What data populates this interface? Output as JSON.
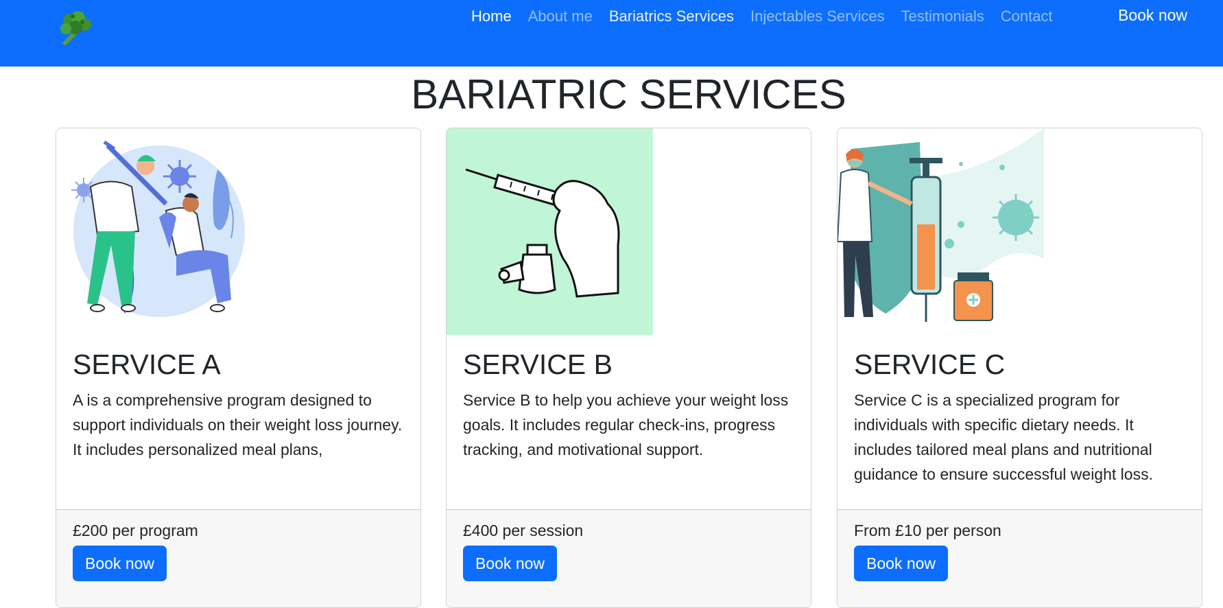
{
  "nav": {
    "brand_icon": "broccoli-icon",
    "links": [
      "Home",
      "About me",
      "Bariatrics Services",
      "Injectables Services",
      "Testimonials",
      "Contact"
    ],
    "book": "Book now"
  },
  "page": {
    "title": "BARIATRIC SERVICES"
  },
  "cards": [
    {
      "image": "doctor-vaccinating-patient-illustration",
      "title": "SERVICE A",
      "text": "A is a comprehensive program designed to support individuals on their weight loss journey. It includes personalized meal plans,",
      "price": "£200 per program",
      "button": "Book now"
    },
    {
      "image": "gloved-hand-syringe-vial-illustration",
      "title": "SERVICE B",
      "text": "Service B to help you achieve your weight loss goals. It includes regular check-ins, progress tracking, and motivational support.",
      "price": "£400 per session",
      "button": "Book now"
    },
    {
      "image": "doctor-giant-syringe-illustration",
      "title": "SERVICE C",
      "text": "Service C is a specialized program for individuals with specific dietary needs. It includes tailored meal plans and nutritional guidance to ensure successful weight loss.",
      "price": "From £10 per person",
      "button": "Book now"
    }
  ],
  "colors": {
    "primary": "#0d6efd",
    "card_b_bg": "#c0f5d6",
    "teal": "#5fb3ad"
  }
}
